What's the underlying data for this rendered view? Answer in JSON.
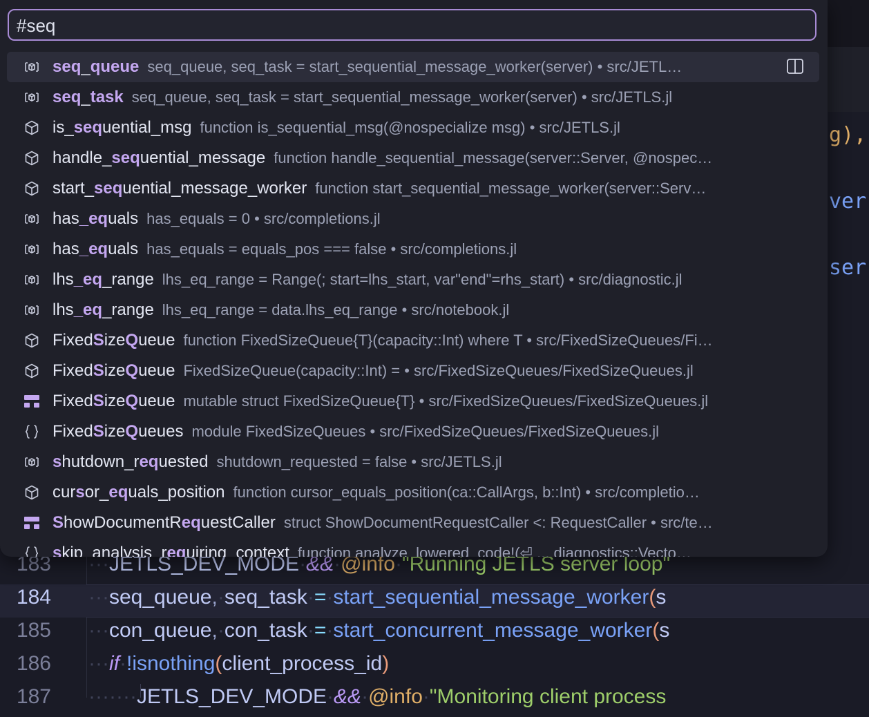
{
  "search": {
    "value": "#seq"
  },
  "results": [
    {
      "icon": "variable-icon",
      "name": [
        "",
        "seq",
        "_",
        "queue",
        ""
      ],
      "detail": "seq_queue, seq_task = start_sequential_message_worker(server) • src/JETL…",
      "selected": true
    },
    {
      "icon": "variable-icon",
      "name": [
        "",
        "seq",
        "_",
        "task",
        ""
      ],
      "detail": "seq_queue, seq_task = start_sequential_message_worker(server) • src/JETLS.jl"
    },
    {
      "icon": "function-icon",
      "name": [
        "is_",
        "seq",
        "uential_msg",
        "",
        ""
      ],
      "detail": "function is_sequential_msg(@nospecialize msg) • src/JETLS.jl"
    },
    {
      "icon": "function-icon",
      "name": [
        "handle_",
        "seq",
        "uential_message",
        "",
        ""
      ],
      "detail": "function handle_sequential_message(server::Server, @nospec…"
    },
    {
      "icon": "function-icon",
      "name": [
        "start_",
        "seq",
        "uential_message_worker",
        "",
        ""
      ],
      "detail": "function start_sequential_message_worker(server::Serv…"
    },
    {
      "icon": "variable-icon",
      "name": [
        "has",
        "_",
        "",
        "eq",
        "uals"
      ],
      "detail": "has_equals = 0 • src/completions.jl"
    },
    {
      "icon": "variable-icon",
      "name": [
        "has",
        "_",
        "",
        "eq",
        "uals"
      ],
      "detail": "has_equals = equals_pos === false • src/completions.jl"
    },
    {
      "icon": "variable-icon",
      "name": [
        "lhs",
        "_",
        "",
        "eq",
        "_range"
      ],
      "detail": "lhs_eq_range = Range(; start=lhs_start, var\"end\"=rhs_start) • src/diagnostic.jl"
    },
    {
      "icon": "variable-icon",
      "name": [
        "lhs",
        "_",
        "",
        "eq",
        "_range"
      ],
      "detail": "lhs_eq_range = data.lhs_eq_range • src/notebook.jl"
    },
    {
      "icon": "function-icon",
      "name": [
        "Fixed",
        "S",
        "ize",
        "Q",
        "ueue"
      ],
      "detail": "function FixedSizeQueue{T}(capacity::Int) where T • src/FixedSizeQueues/Fi…"
    },
    {
      "icon": "function-icon",
      "name": [
        "Fixed",
        "S",
        "ize",
        "Q",
        "ueue"
      ],
      "detail": "FixedSizeQueue(capacity::Int) = • src/FixedSizeQueues/FixedSizeQueues.jl"
    },
    {
      "icon": "struct-icon",
      "name": [
        "Fixed",
        "S",
        "ize",
        "Q",
        "ueue"
      ],
      "detail": "mutable struct FixedSizeQueue{T} • src/FixedSizeQueues/FixedSizeQueues.jl"
    },
    {
      "icon": "module-icon",
      "name": [
        "Fixed",
        "S",
        "ize",
        "Q",
        "ueues"
      ],
      "detail": "module FixedSizeQueues • src/FixedSizeQueues/FixedSizeQueues.jl"
    },
    {
      "icon": "variable-icon",
      "name": [
        "",
        "s",
        "hutdown_r",
        "eq",
        "uested"
      ],
      "detail": "shutdown_requested = false • src/JETLS.jl"
    },
    {
      "icon": "function-icon",
      "name": [
        "cur",
        "s",
        "or_",
        "eq",
        "uals_position"
      ],
      "detail": "function cursor_equals_position(ca::CallArgs, b::Int) • src/completio…"
    },
    {
      "icon": "struct-icon",
      "name": [
        "",
        "S",
        "howDocumentR",
        "eq",
        "uestCaller"
      ],
      "detail": "struct ShowDocumentRequestCaller <: RequestCaller • src/te…"
    },
    {
      "icon": "module-icon",
      "name": [
        "",
        "s",
        "kip_analysis_r",
        "eq",
        "uiring_context"
      ],
      "detail": "function analyze_lowered_code!(⏎ ... diagnostics::Vecto…"
    }
  ],
  "editor": {
    "fragments": [
      "g),",
      "ver",
      "ser"
    ],
    "lines": [
      {
        "num": "183",
        "active": false
      },
      {
        "num": "184",
        "active": true
      },
      {
        "num": "185",
        "active": false
      },
      {
        "num": "186",
        "active": false
      },
      {
        "num": "187",
        "active": false
      }
    ],
    "tokens": {
      "l183": {
        "a": "JETLS_DEV_MODE",
        "b": "&&",
        "c": "@info",
        "d": "\"Running JETLS server loop\""
      },
      "l184": {
        "a": "seq_queue",
        "b": ",",
        "c": "seq_task",
        "d": "=",
        "e": "start_sequential_message_worker",
        "f": "(",
        "g": "s"
      },
      "l185": {
        "a": "con_queue",
        "b": ",",
        "c": "con_task",
        "d": "=",
        "e": "start_concurrent_message_worker",
        "f": "(",
        "g": "s"
      },
      "l186": {
        "a": "if",
        "b": "!isnothing",
        "c": "(",
        "d": "client_process_id",
        "e": ")"
      },
      "l187": {
        "a": "JETLS_DEV_MODE",
        "b": "&&",
        "c": "@info",
        "d": "\"Monitoring client process"
      }
    }
  },
  "colors": {
    "accent": "#c4a7f0",
    "border": "#a88bd6",
    "bg": "#1f2029"
  }
}
